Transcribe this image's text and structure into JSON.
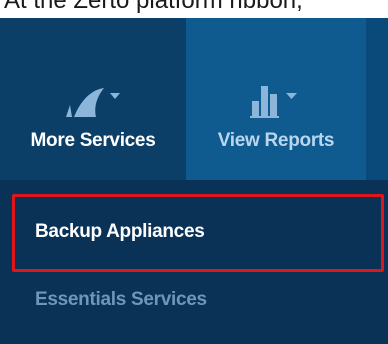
{
  "caption": {
    "text": "At the Zerto platform ribbon,"
  },
  "ribbon": {
    "more_services": {
      "label": "More Services",
      "icon": "shark-fin-icon"
    },
    "view_reports": {
      "label": "View Reports",
      "icon": "bar-chart-icon"
    }
  },
  "dropdown": {
    "items": [
      {
        "label": "Backup Appliances",
        "highlighted": true
      },
      {
        "label": "Essentials Services",
        "highlighted": false
      }
    ]
  },
  "colors": {
    "ribbon_dark": "#0b3f68",
    "ribbon_light": "#0f5a8f",
    "dropdown_bg": "#0a3256",
    "highlight_border": "#e0161b",
    "muted_text": "#6f95b8"
  }
}
